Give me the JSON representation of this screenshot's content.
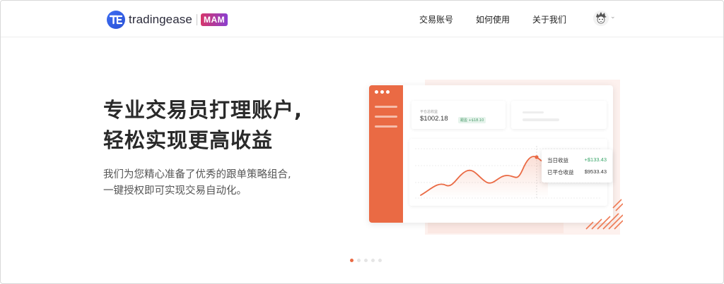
{
  "brand": {
    "logo_icon": "tradingease-logo-icon",
    "name": "tradingease",
    "badge": "MAM",
    "accent": "#3d6df2"
  },
  "nav": {
    "items": [
      {
        "label": "交易账号"
      },
      {
        "label": "如何使用"
      },
      {
        "label": "关于我们"
      }
    ],
    "avatar_icon": "user-avatar-icon",
    "caret_icon": "chevron-down-icon"
  },
  "hero": {
    "title_line1": "专业交易员打理账户,",
    "title_line2": "轻松实现更高收益",
    "sub_line1": "我们为您精心准备了优秀的跟单策略组合,",
    "sub_line2": "一键授权即可实现交易自动化。"
  },
  "illustration": {
    "accent": "#ea6a44",
    "panel1": {
      "label": "平仓总收益",
      "value": "$1002.18",
      "tag": "跟盈 +$18.10"
    },
    "tooltip": {
      "rows": [
        {
          "label": "当日收益",
          "value": "+$133.43",
          "color": "#3aa66a"
        },
        {
          "label": "已平仓收益",
          "value": "$9533.43",
          "color": "#333333"
        }
      ]
    }
  },
  "carousel": {
    "count": 5,
    "active_index": 0,
    "active_color": "#ea6a44"
  }
}
